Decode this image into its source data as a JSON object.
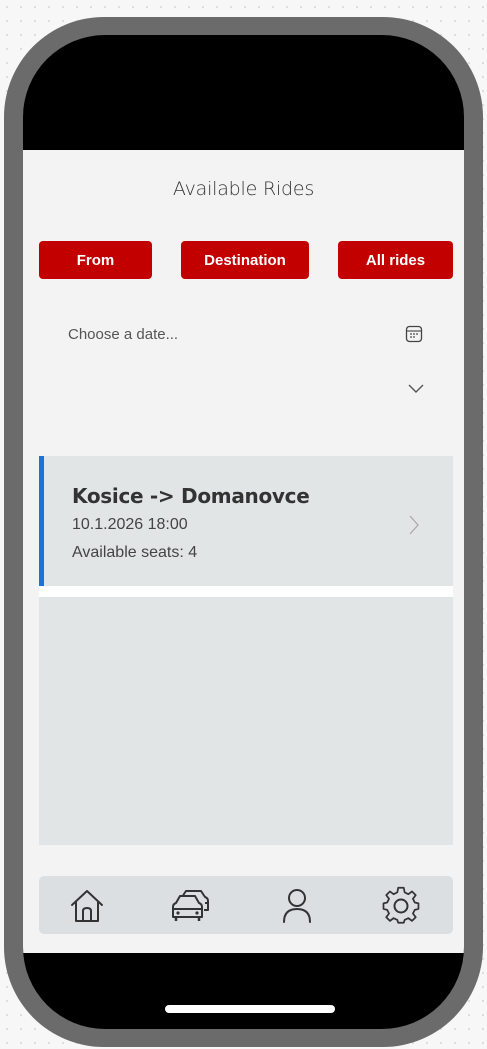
{
  "header": {
    "title": "Available Rides"
  },
  "filters": {
    "from_label": "From",
    "destination_label": "Destination",
    "all_rides_label": "All rides"
  },
  "date_picker": {
    "placeholder": "Choose a date...",
    "icon": "calendar-icon",
    "dropdown_icon": "chevron-down-icon"
  },
  "rides": [
    {
      "route": "Kosice -> Domanovce",
      "datetime": "10.1.2026 18:00",
      "seats": "Available seats: 4"
    }
  ],
  "navigation": {
    "items": [
      {
        "icon": "home-icon"
      },
      {
        "icon": "cars-icon"
      },
      {
        "icon": "profile-icon"
      },
      {
        "icon": "settings-icon"
      }
    ]
  },
  "colors": {
    "accent": "#c20000",
    "selected_indicator": "#1a73d6",
    "device_frame": "#6b6b6b",
    "screen_bg": "#f3f3f3",
    "list_bg": "#e1e5e5",
    "navbar_bg": "#dbdfe2"
  }
}
